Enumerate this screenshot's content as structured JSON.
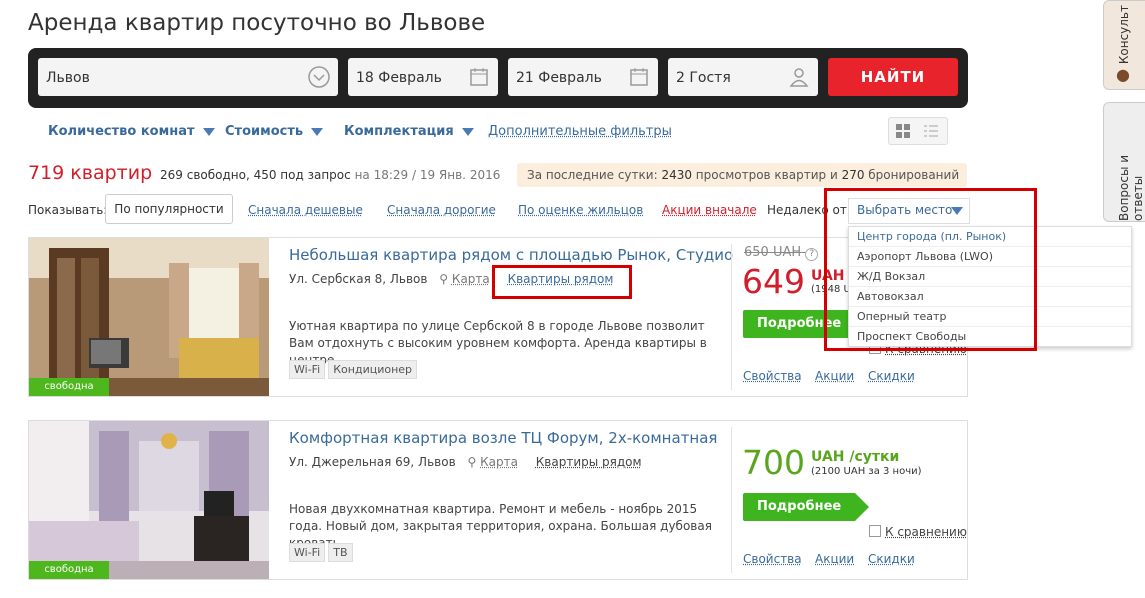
{
  "page_title": "Аренда квартир посуточно во Львове",
  "search": {
    "city": "Львов",
    "checkin": "18 Февраль",
    "checkout": "21 Февраль",
    "guests": "2 Гостя",
    "find_label": "НАЙТИ"
  },
  "filters": {
    "rooms": "Количество комнат",
    "cost": "Стоимость",
    "equipment": "Комплектация",
    "more": "Дополнительные фильтры"
  },
  "results": {
    "count": "719 квартир",
    "free": "269 свободно, 450 под запрос",
    "time_prefix": "на 18:29 / 19 Янв. 2016",
    "stats_prefix": "За последние сутки: ",
    "stats_views": "2430",
    "stats_mid": " просмотров квартир и ",
    "stats_bookings": "270",
    "stats_suffix": " бронирований"
  },
  "sort": {
    "show_label": "Показывать:",
    "popular": "По популярности",
    "cheap": "Сначала дешевые",
    "expensive": "Сначала дорогие",
    "rating": "По оценке жильцов",
    "promo": "Акции вначале",
    "near_label": "Недалеко от:",
    "near_select": "Выбрать место"
  },
  "near_options": [
    "Центр города (пл. Рынок)",
    "Аэропорт Львова (LWO)",
    "Ж/Д Вокзал",
    "Автовокзал",
    "Оперный театр",
    "Проспект Свободы"
  ],
  "listings": [
    {
      "title": "Небольшая квартира рядом с площадью Рынок, Студио",
      "address": "Ул. Сербская 8, Львов",
      "map": "Карта",
      "nearby": "Квартиры рядом",
      "desc": "Уютная квартира по улице Сербской 8 в городе Львове позволит Вам отдохнуть с высоким уровнем комфорта. Аренда квартиры в центре",
      "tags": [
        "Wi-Fi",
        "Кондиционер"
      ],
      "old_price": "650 UAH",
      "price": "649",
      "currency": "UAH",
      "per": "/",
      "subtotal": "(1948 U",
      "badge": "свободна",
      "more": "Подробнее",
      "compare": "К сравнению",
      "links": [
        "Свойства",
        "Акции",
        "Скидки"
      ],
      "price_color": "#d01f2a"
    },
    {
      "title": "Комфортная квартира возле ТЦ Форум, 2х-комнатная",
      "address": "Ул. Джерельная 69, Львов",
      "map": "Карта",
      "nearby": "Квартиры рядом",
      "desc": "Новая двухкомнатная квартира. Ремонт и мебель - ноябрь 2015 года. Новый дом, закрытая территория, охрана. Большая дубовая кровать",
      "tags": [
        "Wi-Fi",
        "TB"
      ],
      "price": "700",
      "currency": "UAH",
      "per": "/сутки",
      "subtotal": "(2100 UAH за 3 ночи)",
      "badge": "свободна",
      "more": "Подробнее",
      "compare": "К сравнению",
      "links": [
        "Свойства",
        "Акции",
        "Скидки"
      ],
      "price_color": "#5aa51e"
    }
  ],
  "side": {
    "consult": "Консульт",
    "faq": "Вопросы и ответы"
  },
  "colors": {
    "accent": "#e8232c",
    "link": "#3a6a9a",
    "green": "#3eb51f"
  }
}
